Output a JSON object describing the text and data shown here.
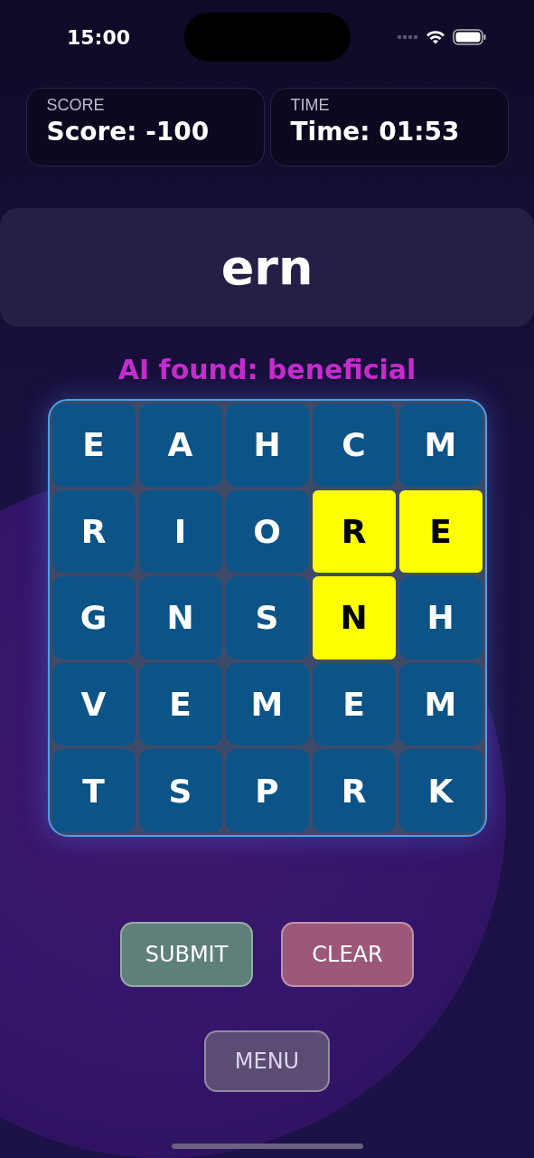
{
  "status_bar": {
    "time": "15:00"
  },
  "stats": [
    {
      "label": "SCORE",
      "value": "Score: -100"
    },
    {
      "label": "TIME",
      "value": "Time: 01:53"
    }
  ],
  "current_word": "ern",
  "grid": {
    "overlay_message": "AI found: beneficial",
    "rows": [
      [
        {
          "letter": "E",
          "selected": false
        },
        {
          "letter": "A",
          "selected": false
        },
        {
          "letter": "H",
          "selected": false
        },
        {
          "letter": "C",
          "selected": false
        },
        {
          "letter": "M",
          "selected": false
        }
      ],
      [
        {
          "letter": "R",
          "selected": false
        },
        {
          "letter": "I",
          "selected": false
        },
        {
          "letter": "O",
          "selected": false
        },
        {
          "letter": "R",
          "selected": true
        },
        {
          "letter": "E",
          "selected": true
        }
      ],
      [
        {
          "letter": "G",
          "selected": false
        },
        {
          "letter": "N",
          "selected": false
        },
        {
          "letter": "S",
          "selected": false
        },
        {
          "letter": "N",
          "selected": true
        },
        {
          "letter": "H",
          "selected": false
        }
      ],
      [
        {
          "letter": "V",
          "selected": false
        },
        {
          "letter": "E",
          "selected": false
        },
        {
          "letter": "M",
          "selected": false
        },
        {
          "letter": "E",
          "selected": false
        },
        {
          "letter": "M",
          "selected": false
        }
      ],
      [
        {
          "letter": "T",
          "selected": false
        },
        {
          "letter": "S",
          "selected": false
        },
        {
          "letter": "P",
          "selected": false
        },
        {
          "letter": "R",
          "selected": false
        },
        {
          "letter": "K",
          "selected": false
        }
      ]
    ]
  },
  "actions": [
    {
      "label": "SUBMIT",
      "kind": "submit"
    },
    {
      "label": "CLEAR",
      "kind": "clear"
    }
  ],
  "menu_button": "MENU"
}
